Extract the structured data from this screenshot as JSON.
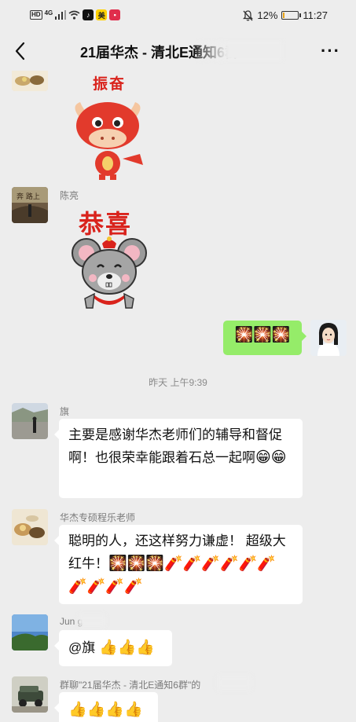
{
  "status_bar": {
    "network_hd": "HD",
    "network_type": "4G",
    "app_badge": "美",
    "battery": "12%",
    "battery_level": 0.12,
    "time": "11:27"
  },
  "nav": {
    "title": "21届华杰 - 清北E通知6群",
    "back_icon": "back-arrow-icon",
    "more_icon": "more-dots-icon"
  },
  "messages": [
    {
      "id": "m1",
      "sender": "",
      "type": "sticker",
      "sticker_text": "振奋",
      "icon": "red-ox-sticker-icon"
    },
    {
      "id": "m2",
      "sender": "陈亮",
      "type": "sticker",
      "sticker_text": "恭喜",
      "icon": "mouse-sticker-icon"
    },
    {
      "id": "m3",
      "sender": "me",
      "type": "emoji",
      "text": "🎇🎇🎇"
    },
    {
      "id": "sep1",
      "type": "time",
      "text": "昨天 上午9:39"
    },
    {
      "id": "m4",
      "sender": "旗",
      "type": "text",
      "text": "主要是感谢华杰老师们的辅导和督促啊！也很荣幸能跟着石总一起啊",
      "emoji": "😁😁"
    },
    {
      "id": "m5",
      "sender": "华杰专硕程乐老师",
      "type": "text",
      "text": "聪明的人，还这样努力谦虚！ 超级大红牛！",
      "emoji": "🎇🎇🎇🧨🧨🧨🧨🧨🧨🧨🧨🧨🧨"
    },
    {
      "id": "m6",
      "sender": "Jun  g",
      "type": "text",
      "text": "@旗 ",
      "emoji": "👍👍👍"
    },
    {
      "id": "m7",
      "sender": "群聊\"21届华杰 - 清北E通知6群\"的",
      "type": "text",
      "text": "",
      "emoji": "👍👍👍👍"
    }
  ]
}
